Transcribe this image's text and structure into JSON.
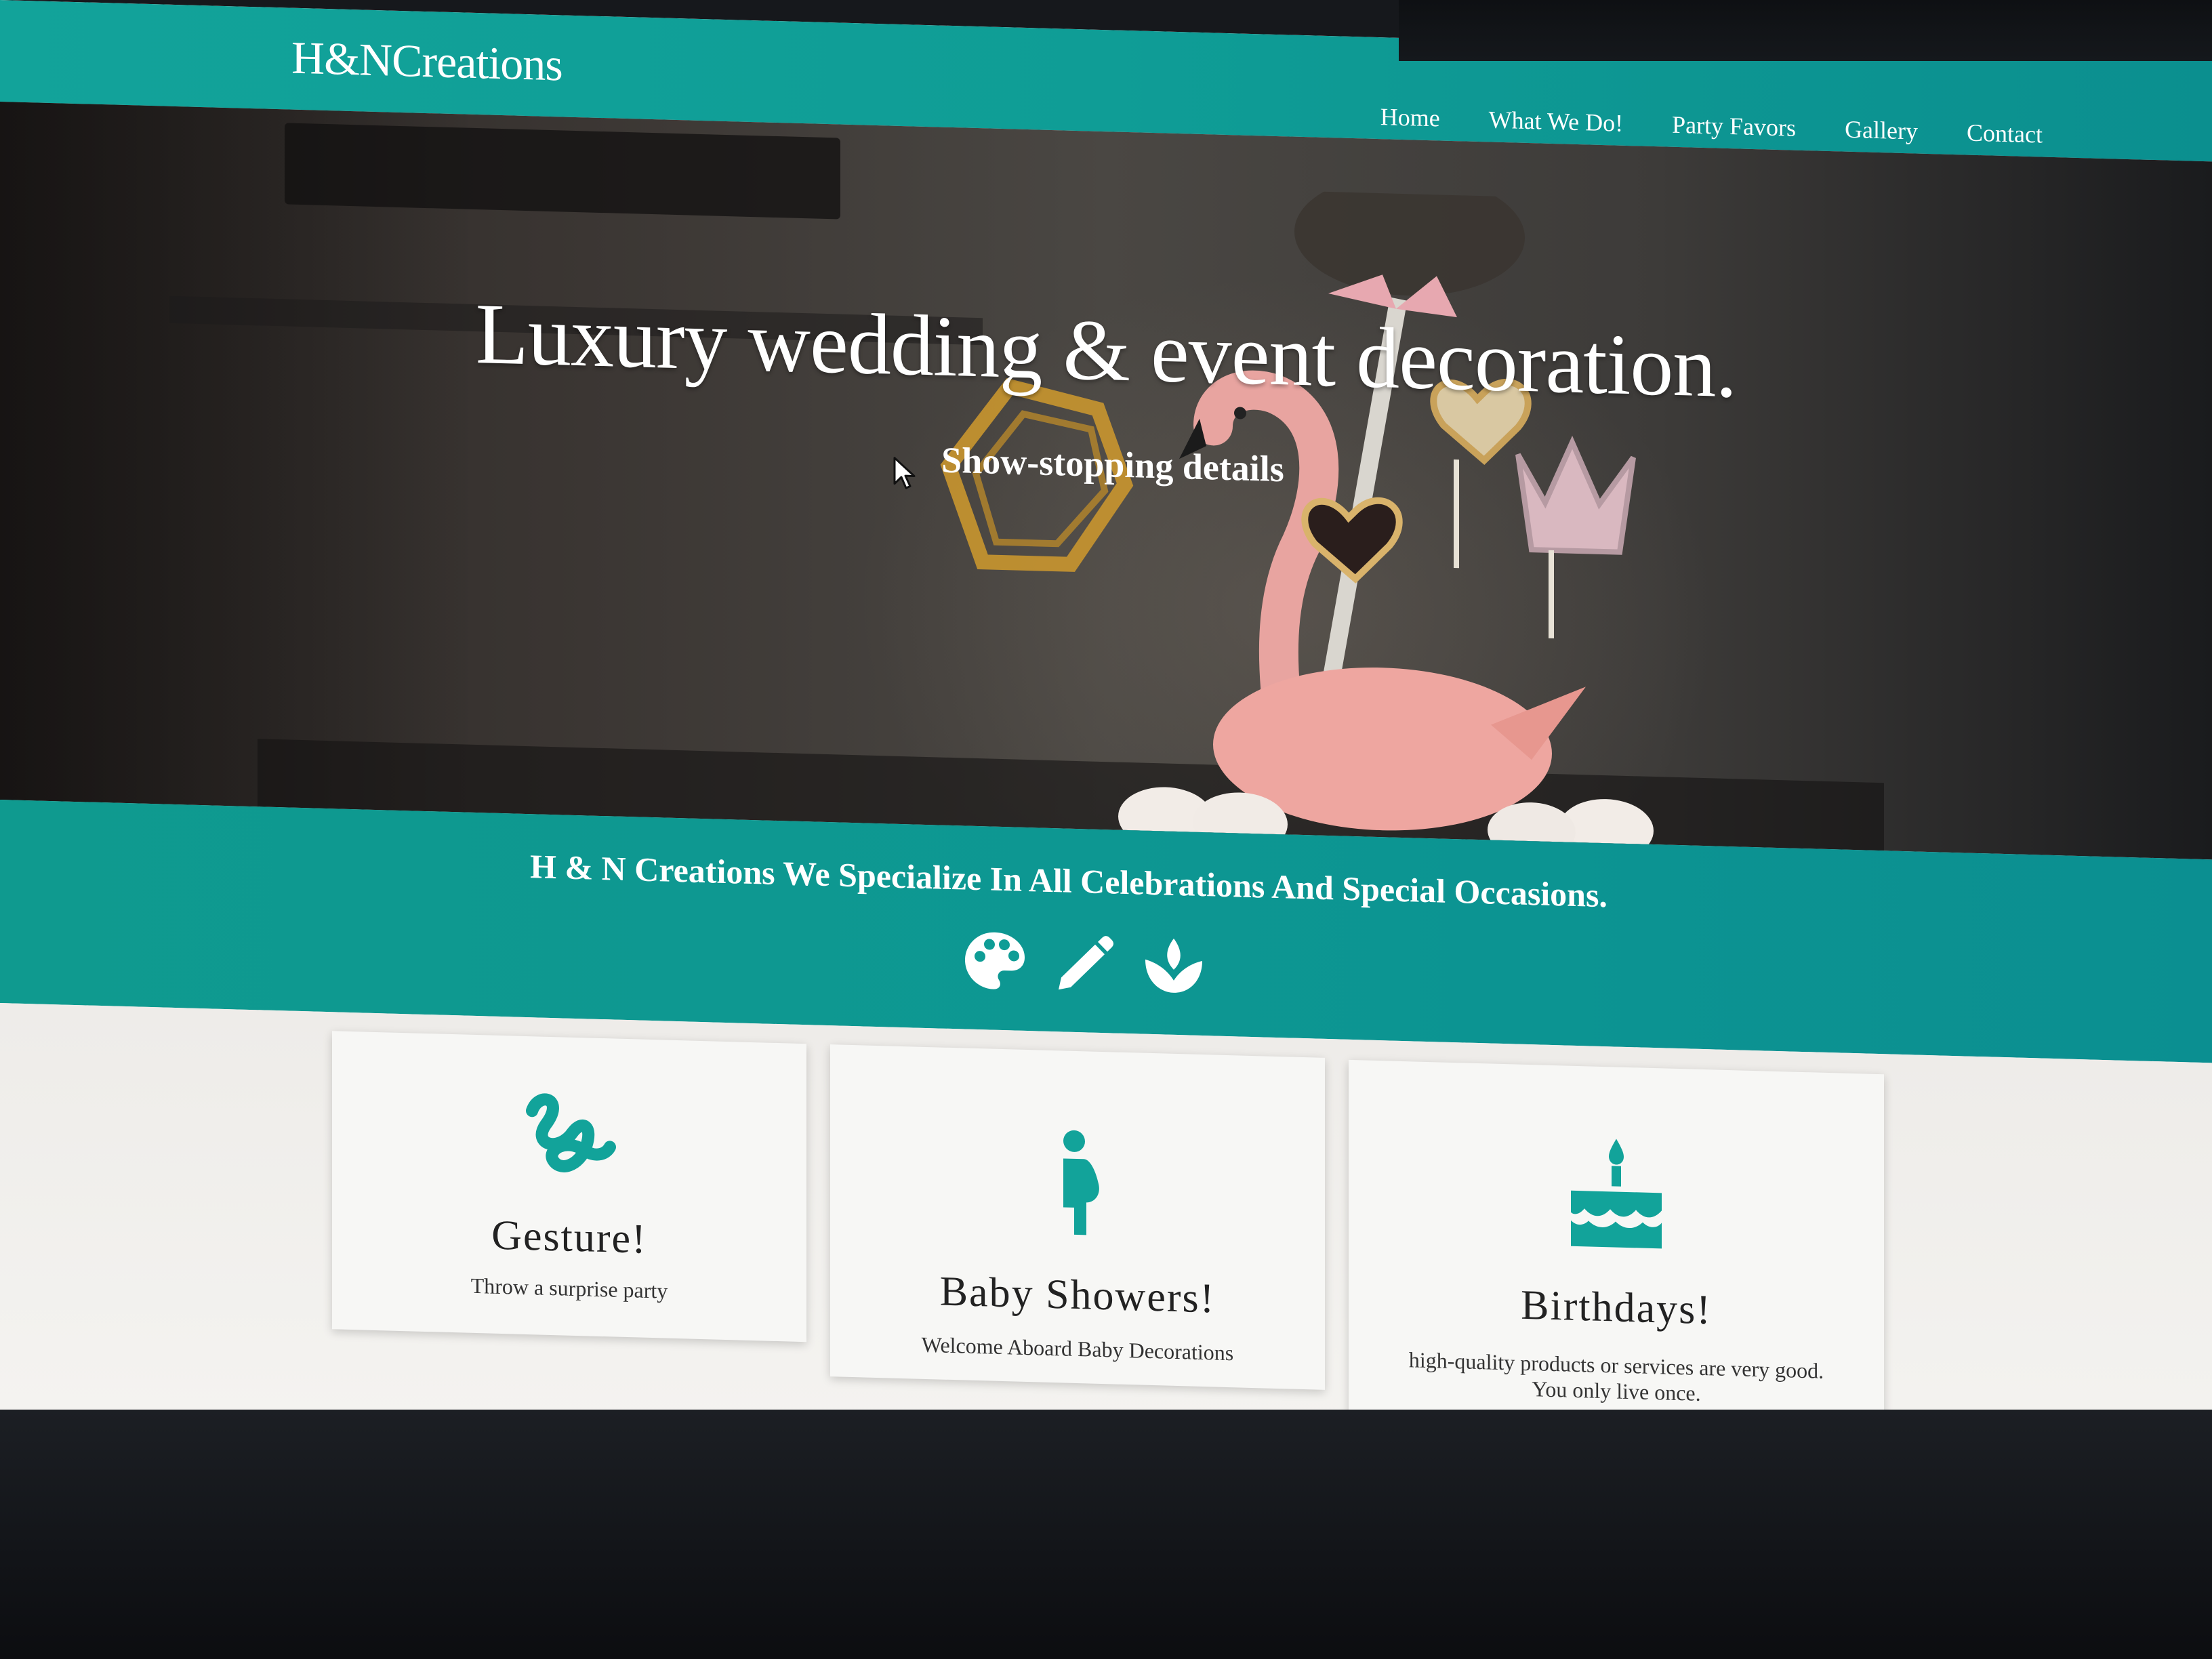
{
  "header": {
    "brand": "H&NCreations",
    "nav": [
      "Home",
      "What We Do!",
      "Party Favors",
      "Gallery",
      "Contact"
    ]
  },
  "hero": {
    "title": "Luxury wedding & event decoration.",
    "subtitle": "Show-stopping details"
  },
  "band": {
    "text": "H & N Creations We Specialize In All Celebrations And Special Occasions.",
    "icons": [
      "palette-icon",
      "pencil-icon",
      "leaf-icon"
    ]
  },
  "cards": [
    {
      "icon": "squiggle-icon",
      "title": "Gesture!",
      "text": "Throw a surprise party"
    },
    {
      "icon": "pregnant-person-icon",
      "title": "Baby Showers!",
      "text": "Welcome Aboard Baby Decorations"
    },
    {
      "icon": "birthday-cake-icon",
      "title": "Birthdays!",
      "text": "high-quality products or services are very good. You only live once."
    }
  ],
  "colors": {
    "accent": "#0f9d96",
    "icon": "#12a39a",
    "white": "#ffffff"
  }
}
